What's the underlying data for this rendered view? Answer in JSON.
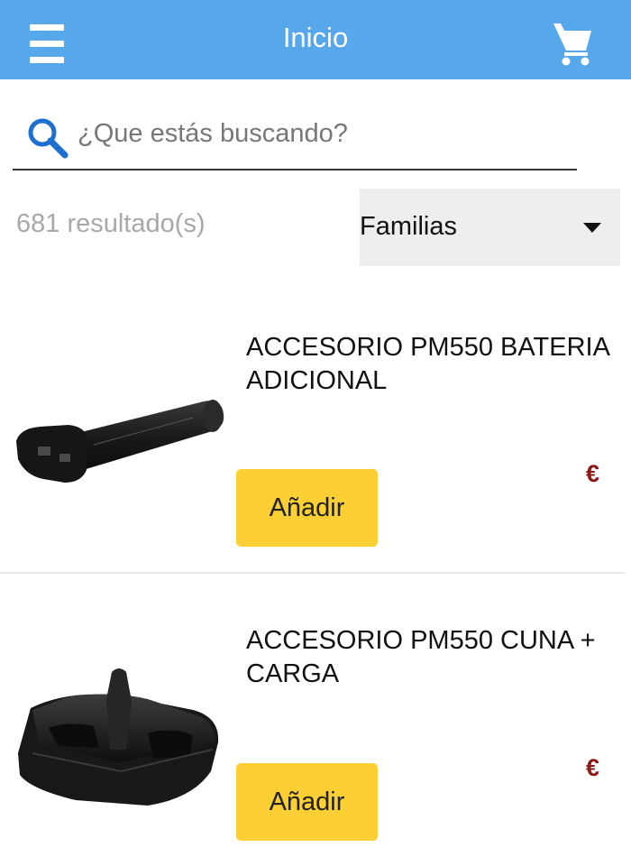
{
  "header": {
    "title": "Inicio",
    "menu_icon": "hamburger-menu-icon",
    "cart_icon": "shopping-cart-icon",
    "color": "#57a8ea"
  },
  "search": {
    "placeholder": "¿Que estás buscando?",
    "value": "",
    "icon": "search-icon"
  },
  "results": {
    "count_text": "681 resultado(s)"
  },
  "filter": {
    "selected": "Familias",
    "icon": "caret-down-icon"
  },
  "products": [
    {
      "name": "ACCESORIO PM550 BATERIA ADICIONAL",
      "add_label": "Añadir",
      "price": "€",
      "image": "battery-product-image"
    },
    {
      "name": "ACCESORIO PM550 CUNA + CARGA",
      "add_label": "Añadir",
      "price": "€",
      "image": "charging-cradle-product-image"
    }
  ],
  "colors": {
    "button": "#fccf35",
    "price": "#8b1a1a"
  }
}
